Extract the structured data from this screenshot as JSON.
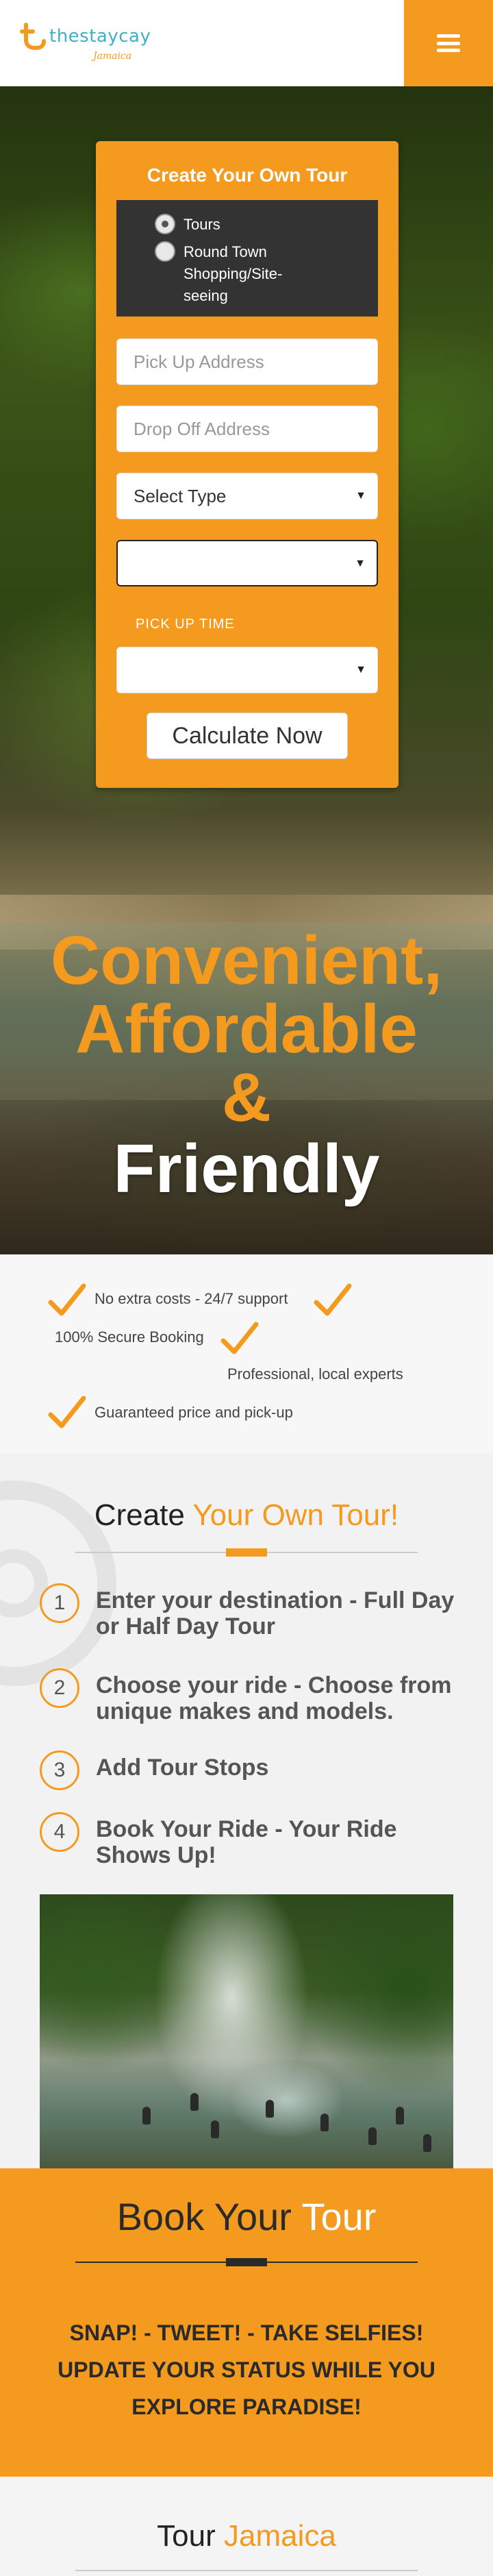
{
  "header": {
    "logo_wordmark": "thestaycay",
    "logo_tagline": "Jamaica",
    "menu_icon": "hamburger-icon",
    "accent_color": "#f39a1f"
  },
  "tour_form": {
    "title": "Create Your Own Tour",
    "options": [
      {
        "label": "Tours",
        "checked": true
      },
      {
        "label": "Round Town Shopping/Site-seeing",
        "checked": false
      }
    ],
    "pickup_placeholder": "Pick Up Address",
    "dropoff_placeholder": "Drop Off Address",
    "type_select": "Select Type",
    "second_select": "",
    "pickup_time_label": "PICK UP TIME",
    "pickup_time_select": "",
    "submit_label": "Calculate Now"
  },
  "hero": {
    "line1": "Convenient,",
    "line2": "Affordable",
    "line3": "&",
    "line4": "Friendly"
  },
  "features": {
    "items": [
      "No extra costs - 24/7 support",
      "100% Secure Booking",
      "Professional, local experts",
      "Guaranteed price and pick-up"
    ],
    "icon": "checkmark-icon"
  },
  "how": {
    "title_plain": "Create ",
    "title_accent": "Your Own Tour!",
    "steps": [
      {
        "num": "1",
        "text": "Enter your destination - Full Day or Half Day Tour"
      },
      {
        "num": "2",
        "text": "Choose your ride - Choose from unique makes and models."
      },
      {
        "num": "3",
        "text": "Add Tour Stops"
      },
      {
        "num": "4",
        "text": "Book Your Ride - Your Ride Shows Up!"
      }
    ]
  },
  "book": {
    "title_plain": "Book Your ",
    "title_accent": "Tour",
    "tagline": [
      "SNAP! - TWEET! - TAKE SELFIES!",
      "UPDATE YOUR STATUS WHILE YOU",
      "EXPLORE PARADISE!"
    ]
  },
  "tour_jamaica": {
    "title_plain": "Tour ",
    "title_accent": "Jamaica"
  }
}
